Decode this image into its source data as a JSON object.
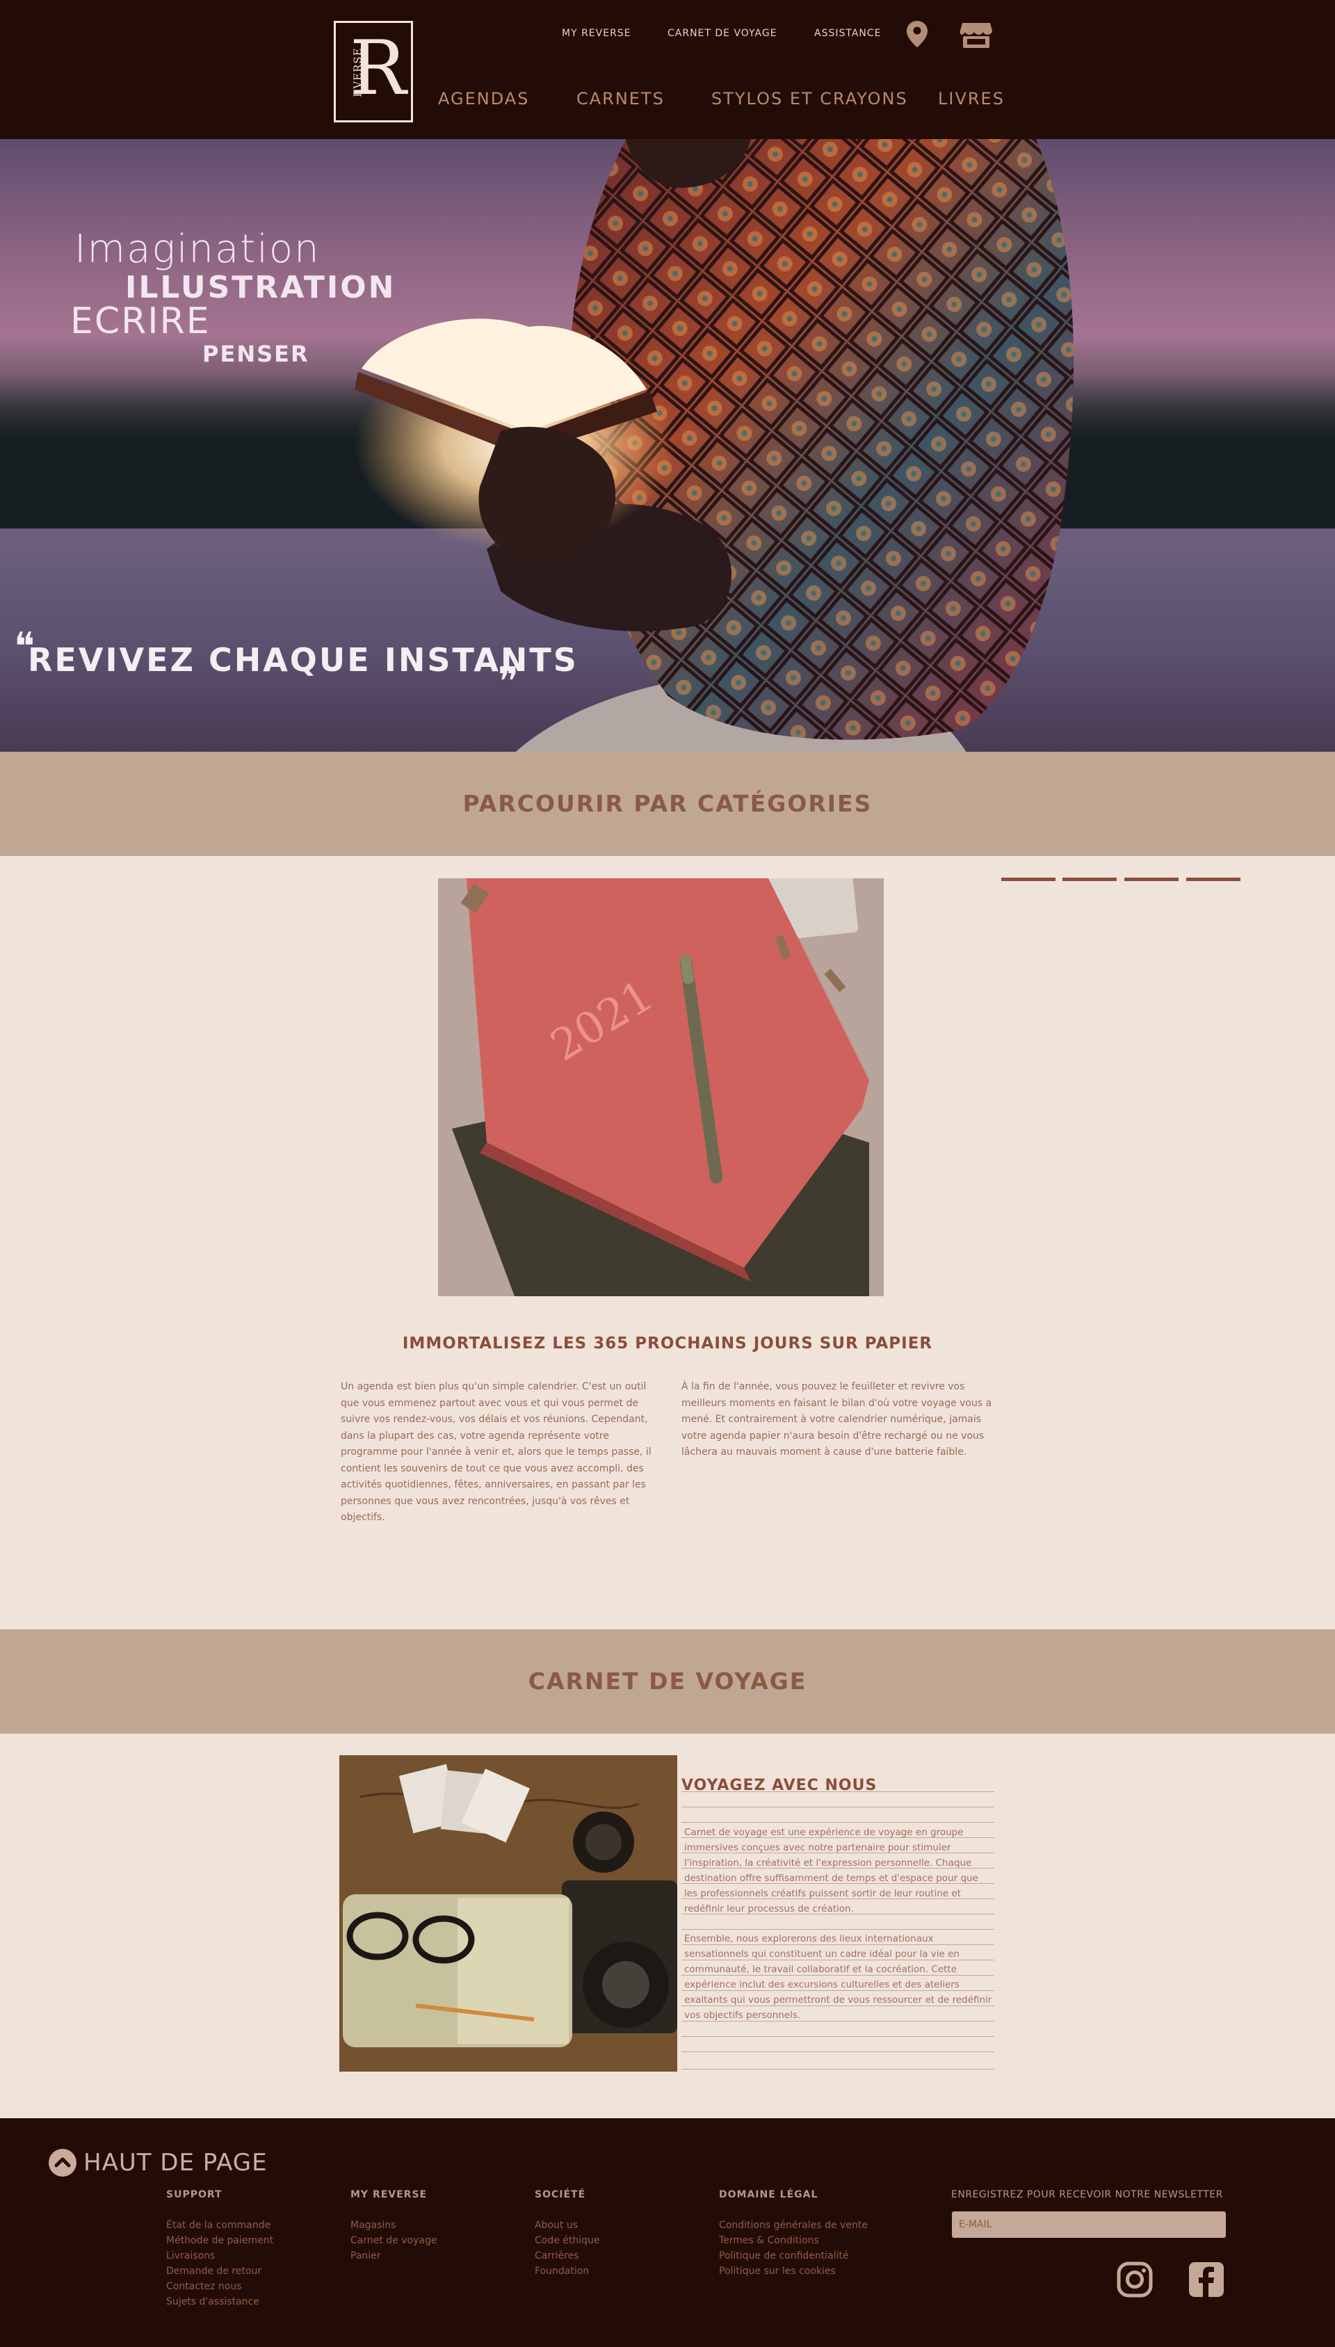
{
  "header": {
    "logo_letter": "R",
    "logo_vertical": "EVERSE",
    "top_links": [
      "MY REVERSE",
      "CARNET DE VOYAGE",
      "ASSISTANCE"
    ],
    "main_nav": [
      "AGENDAS",
      "CARNETS",
      "STYLOS ET CRAYONS",
      "LIVRES"
    ],
    "icons": [
      "location-pin-icon",
      "store-icon"
    ]
  },
  "hero": {
    "words": [
      "Imagination",
      "ILLUSTRATION",
      "ECRIRE",
      "PENSER"
    ],
    "quote": "REVIVEZ CHAQUE INSTANTS"
  },
  "categories": {
    "band_title": "PARCOURIR PAR CATÉGORIES",
    "slider_count": 4,
    "heading": "IMMORTALISEZ LES 365 PROCHAINS JOURS SUR PAPIER",
    "paragraph_left": "Un agenda est bien plus qu'un simple calendrier. C'est un outil que vous emmenez partout avec vous et qui vous permet de suivre vos rendez-vous, vos délais et vos réunions. Cependant, dans la plupart des cas, votre agenda représente votre programme pour l'année à venir et, alors que le temps passe, il contient les souvenirs de tout ce que vous avez accompli, des activités quotidiennes, fêtes, anniversaires, en passant par les personnes que vous avez rencontrées, jusqu'à vos rêves et objectifs.",
    "paragraph_right": "À la fin de l'année, vous pouvez le feuilleter et revivre vos meilleurs moments en faisant le bilan d'où votre voyage vous a mené. Et contrairement à votre calendrier numérique, jamais votre agenda papier n'aura besoin d'être rechargé ou ne vous lâchera au mauvais moment à cause d'une batterie faible."
  },
  "travel": {
    "band_title": "CARNET DE VOYAGE",
    "title": "VOYAGEZ AVEC NOUS",
    "paragraph1": "Carnet de voyage est une expérience de voyage en groupe immersives conçues avec notre partenaire pour stimuler l'inspiration, la créativité et l'expression personnelle. Chaque destination offre suffisamment de temps et d'espace pour que les professionnels créatifs puissent sortir de leur routine et redéfinir leur processus de création.",
    "paragraph2": "Ensemble, nous explorerons des lieux internationaux sensationnels qui constituent un cadre idéal pour la vie en communauté, le travail collaboratif et la cocréation. Cette expérience inclut des excursions culturelles et des ateliers exaltants qui vous permettront de vous ressourcer et de redéfinir vos objectifs personnels."
  },
  "footer": {
    "back_to_top": "HAUT DE PAGE",
    "columns": [
      {
        "heading": "SUPPORT",
        "links": [
          "État de la commande",
          "Méthode de paiement",
          "Livraisons",
          "Demande de retour",
          "Contactez nous",
          "Sujets d'assistance"
        ]
      },
      {
        "heading": "MY REVERSE",
        "links": [
          "Magasins",
          "Carnet de voyage",
          "Panier"
        ]
      },
      {
        "heading": "SOCIÉTÉ",
        "links": [
          "About us",
          "Code éthique",
          "Carrières",
          "Foundation"
        ]
      },
      {
        "heading": "DOMAINE LÉGAL",
        "links": [
          "Conditions générales de vente",
          "Termes & Conditions",
          "Politique de confidentialité",
          "Politique sur les cookies"
        ]
      }
    ],
    "newsletter_label": "ENREGISTREZ POUR RECEVOIR NOTRE NEWSLETTER",
    "newsletter_placeholder": "E-MAIL",
    "social": [
      "instagram-icon",
      "facebook-icon"
    ]
  },
  "colors": {
    "header_bg": "#230c05",
    "band_bg": "#bfa794",
    "page_bg": "#f0e4da",
    "accent": "#8c4d3c"
  }
}
